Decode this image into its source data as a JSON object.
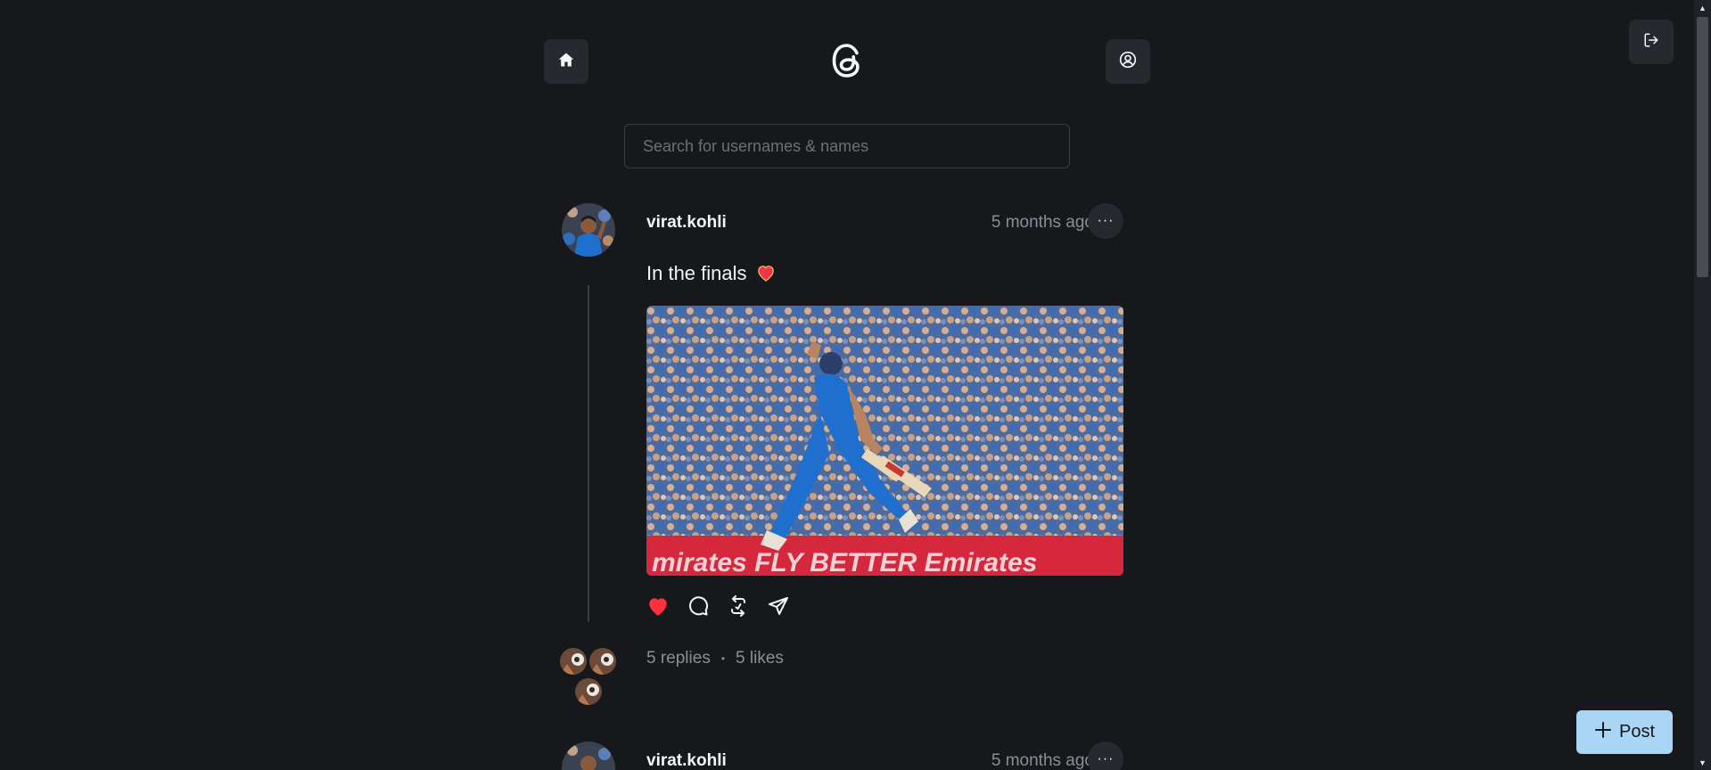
{
  "header": {
    "home_icon": "home-icon",
    "logo_icon": "threads-logo",
    "profile_icon": "user-circle-icon",
    "logout_icon": "logout-icon"
  },
  "search": {
    "placeholder": "Search for usernames & names"
  },
  "posts": [
    {
      "username": "virat.kohli",
      "time": "5 months ago",
      "more": "···",
      "text": "In the finals",
      "emoji": "heart-emoji",
      "image_alt": "Cricketer celebrating in blue jersey",
      "actions": [
        "like-icon",
        "comment-icon",
        "repost-icon",
        "share-icon"
      ],
      "liked": true,
      "replies": "5 replies",
      "separator": "•",
      "likes": "5 likes"
    },
    {
      "username": "virat.kohli",
      "time": "5 months ago",
      "more": "···"
    }
  ],
  "fab": {
    "label": "Post",
    "icon": "plus-icon"
  },
  "colors": {
    "background": "#16181c",
    "button_bg": "#27292e",
    "like_red": "#ff3040",
    "fab_bg": "#a9d6f4",
    "muted_text": "#8b8e94"
  }
}
